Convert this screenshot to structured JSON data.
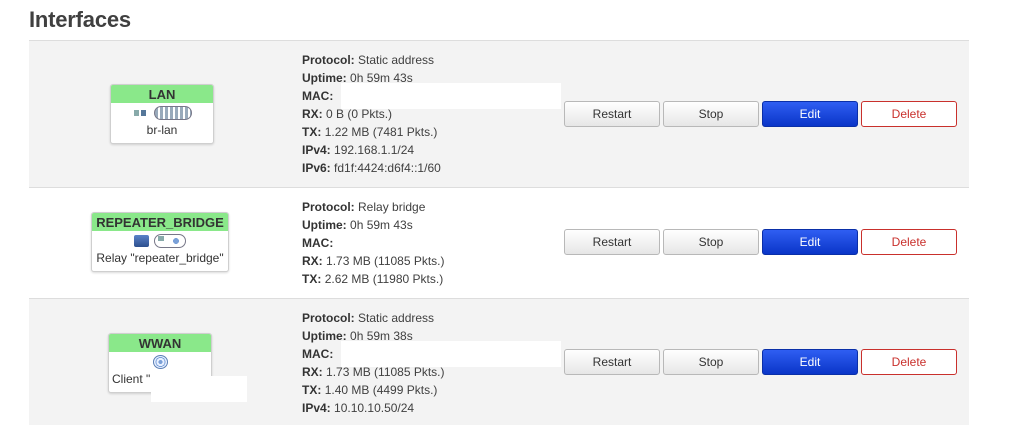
{
  "title": "Interfaces",
  "labels": {
    "protocol": "Protocol:",
    "uptime": "Uptime:",
    "mac": "MAC:",
    "rx": "RX:",
    "tx": "TX:",
    "ipv4": "IPv4:",
    "ipv6": "IPv6:"
  },
  "buttons": {
    "restart": "Restart",
    "stop": "Stop",
    "edit": "Edit",
    "delete": "Delete"
  },
  "interfaces": [
    {
      "name": "LAN",
      "device": "br-lan",
      "icons": [
        "switch-icon",
        "bridge-icon"
      ],
      "protocol": "Static address",
      "uptime": "0h 59m 43s",
      "mac": "",
      "rx": "0 B (0 Pkts.)",
      "tx": "1.22 MB (7481 Pkts.)",
      "ipv4": "192.168.1.1/24",
      "ipv6": "fd1f:4424:d6f4::1/60"
    },
    {
      "name": "REPEATER_BRIDGE",
      "device": "Relay \"repeater_bridge\"",
      "icons": [
        "network-icon",
        "relay-group-icon"
      ],
      "protocol": "Relay bridge",
      "uptime": "0h 59m 43s",
      "mac": "",
      "rx": "1.73 MB (11085 Pkts.)",
      "tx": "2.62 MB (11980 Pkts.)"
    },
    {
      "name": "WWAN",
      "device": "Client \"",
      "icons": [
        "wifi-icon"
      ],
      "protocol": "Static address",
      "uptime": "0h 59m 38s",
      "mac": "",
      "rx": "1.73 MB (11085 Pkts.)",
      "tx": "1.40 MB (4499 Pkts.)",
      "ipv4": "10.10.10.50/24"
    }
  ]
}
